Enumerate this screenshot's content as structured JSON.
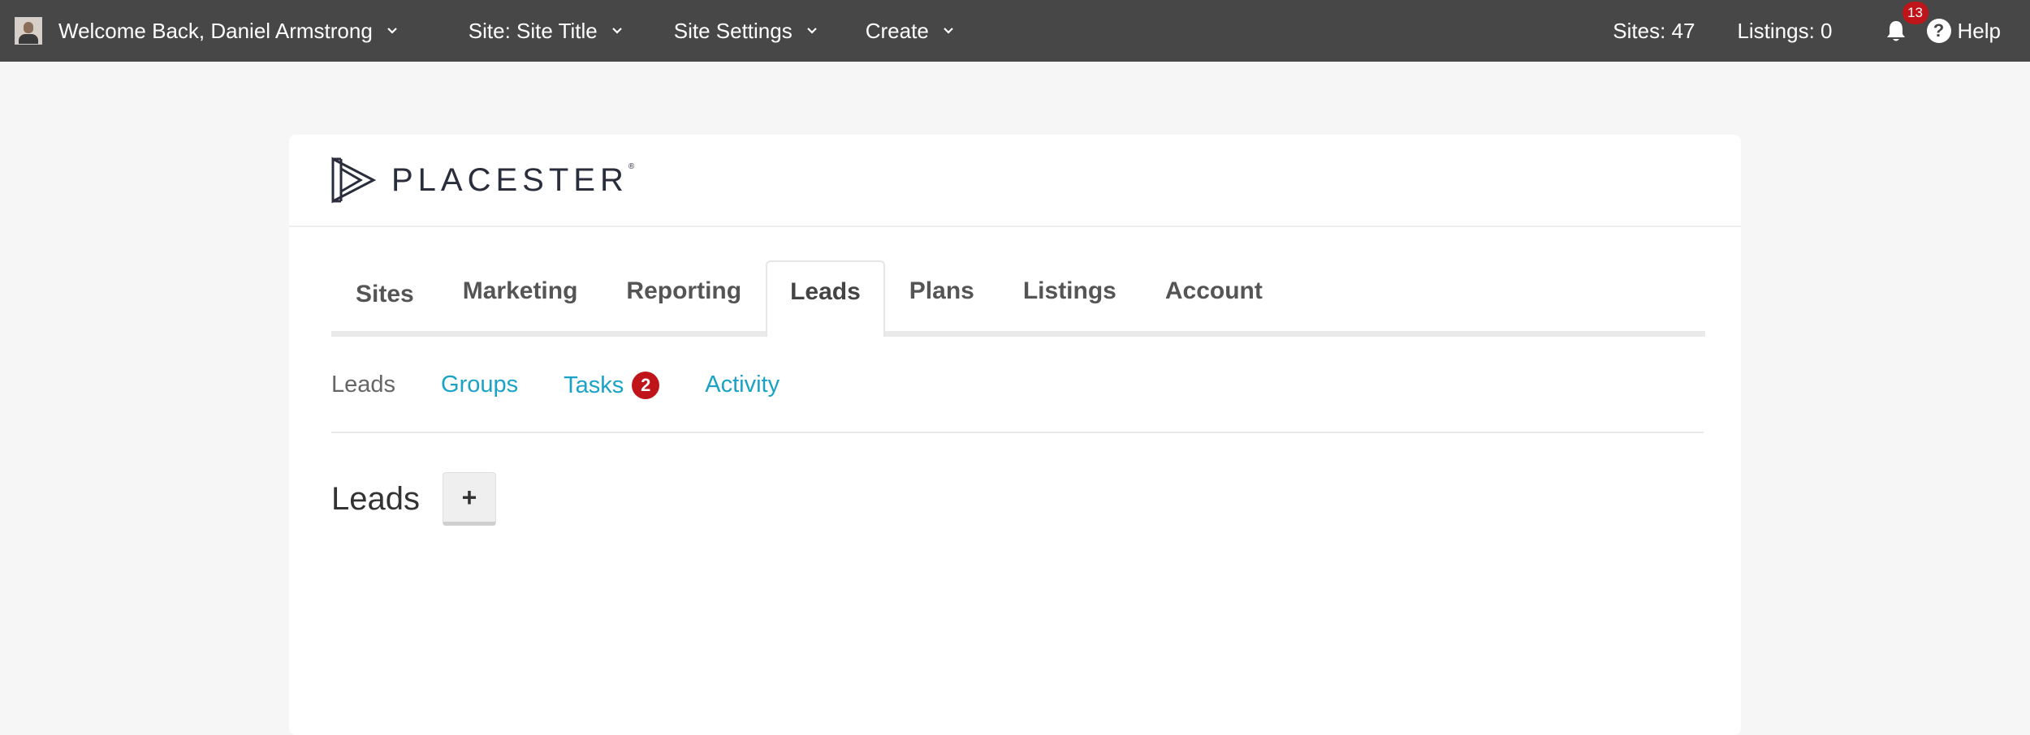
{
  "topbar": {
    "welcome": "Welcome Back, Daniel Armstrong",
    "site": "Site: Site Title",
    "site_settings": "Site Settings",
    "create": "Create",
    "sites_count": "Sites: 47",
    "listings_count": "Listings: 0",
    "notifications": "13",
    "help": "Help"
  },
  "logo": {
    "text": "PLACESTER"
  },
  "main_tabs": [
    "Sites",
    "Marketing",
    "Reporting",
    "Leads",
    "Plans",
    "Listings",
    "Account"
  ],
  "active_tab": "Leads",
  "sub_tabs": {
    "leads": "Leads",
    "groups": "Groups",
    "tasks": "Tasks",
    "tasks_badge": "2",
    "activity": "Activity"
  },
  "page": {
    "title": "Leads",
    "add_label": "+"
  },
  "colors": {
    "topbar": "#474747",
    "link": "#1aa3c7",
    "badge": "#c0141b"
  }
}
